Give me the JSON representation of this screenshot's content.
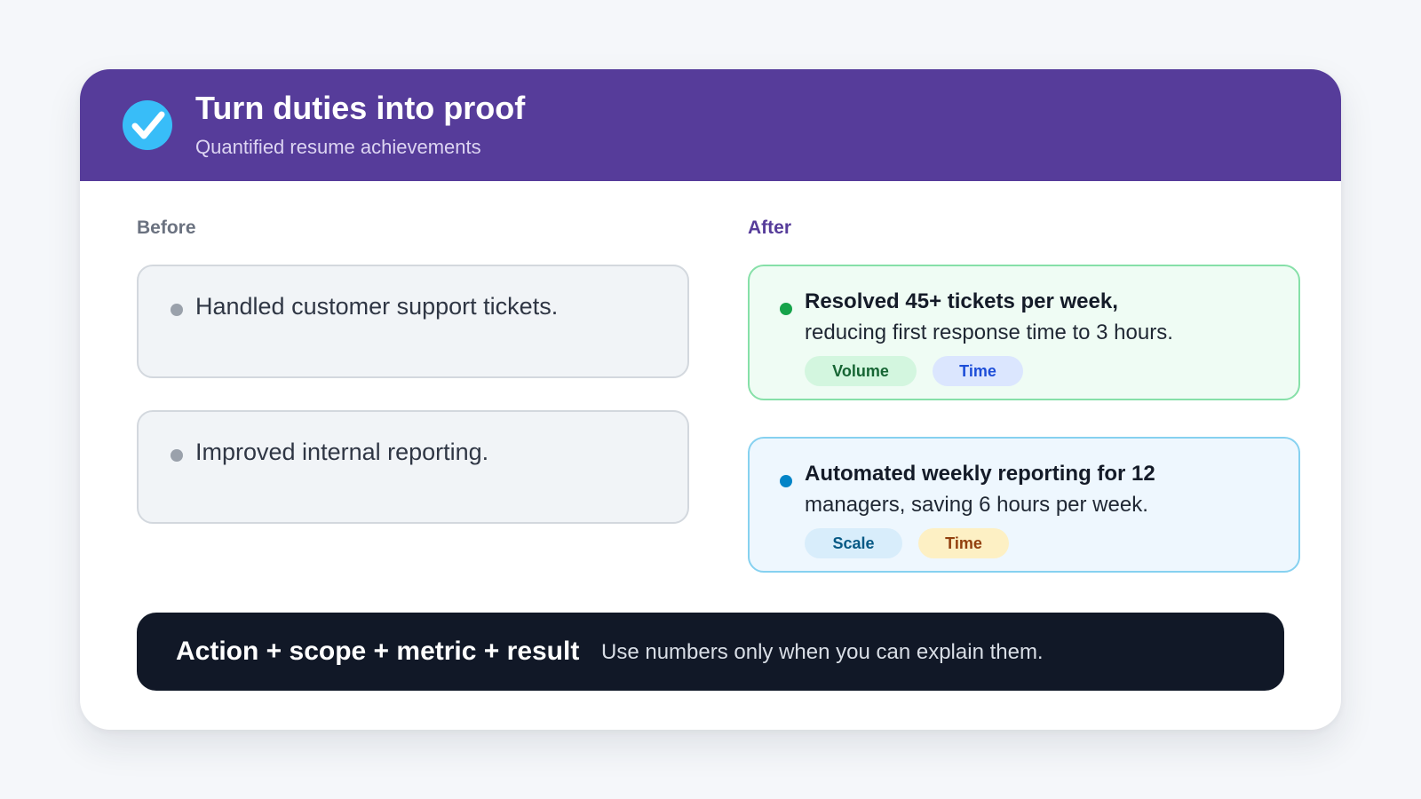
{
  "header": {
    "title": "Turn duties into proof",
    "subtitle": "Quantified resume achievements",
    "icon": "check-circle-icon",
    "background": "#563c9a"
  },
  "before": {
    "label": "Before",
    "items": [
      {
        "text": "Handled customer support tickets."
      },
      {
        "text": "Improved internal reporting."
      }
    ]
  },
  "after": {
    "label": "After",
    "items": [
      {
        "lead": "Resolved 45+ tickets per week,",
        "rest": "reducing first response time to 3 hours.",
        "dot_color": "#16a34a",
        "tags": [
          {
            "label": "Volume",
            "bg": "#d3f6df",
            "color": "#166534"
          },
          {
            "label": "Time",
            "bg": "#dbe6fe",
            "color": "#1d4ed8"
          }
        ]
      },
      {
        "lead": "Automated weekly reporting for 12",
        "rest": "managers, saving 6 hours per week.",
        "dot_color": "#0284c7",
        "tags": [
          {
            "label": "Scale",
            "bg": "#d8edfb",
            "color": "#075985"
          },
          {
            "label": "Time",
            "bg": "#fdf0c4",
            "color": "#92400e"
          }
        ]
      }
    ]
  },
  "footer": {
    "formula": "Action + scope + metric + result",
    "note": "Use numbers only when you can explain them."
  }
}
